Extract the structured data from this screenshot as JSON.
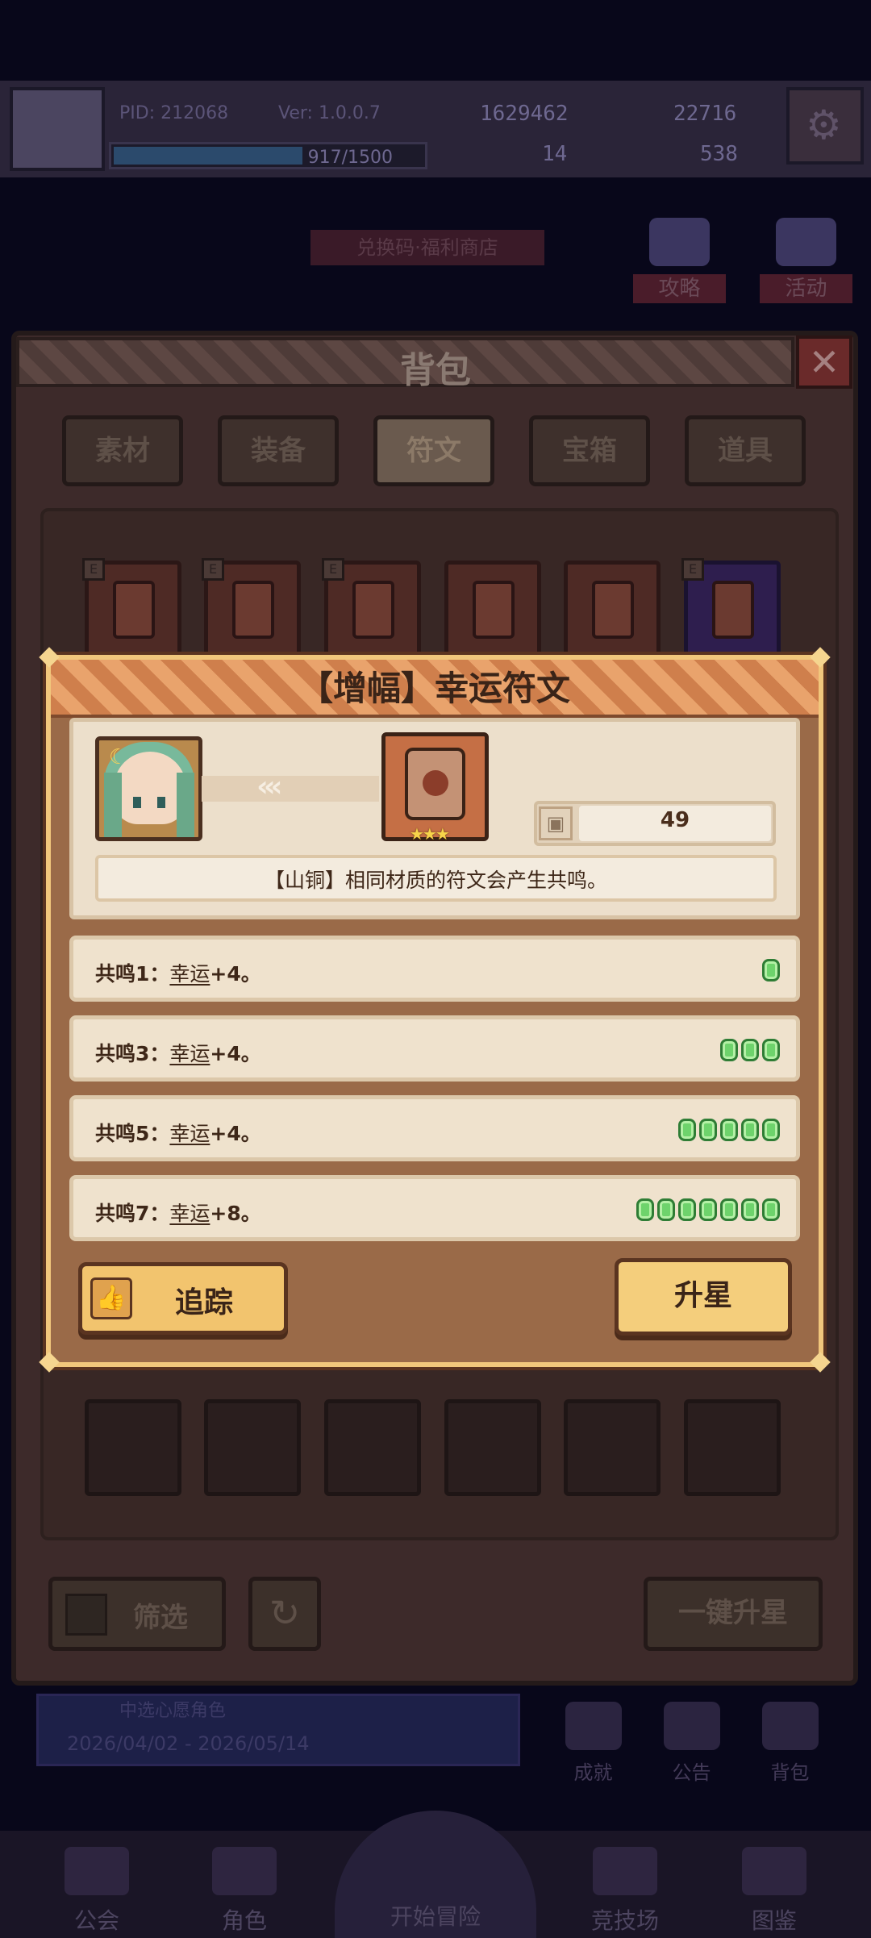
{
  "player": {
    "pid": "PID: 212068",
    "version": "Ver: 1.0.0.7",
    "coins": "1629462",
    "gems": "22716",
    "xp": "917/1500",
    "xp_fraction": 0.61,
    "clover": "14",
    "boots": "538"
  },
  "background": {
    "ribbon": "兑换码·福利商店",
    "side_buttons": [
      "攻略",
      "活动"
    ],
    "banner_top": "中选心愿角色",
    "banner_date": "2026/04/02 - 2026/05/14",
    "mini_buttons": [
      "成就",
      "公告",
      "背包"
    ],
    "nav": [
      "公会",
      "角色",
      "开始冒险",
      "竞技场",
      "图鉴"
    ]
  },
  "backpack": {
    "title": "背包",
    "close": "✕",
    "tabs": [
      "素材",
      "装备",
      "符文",
      "宝箱",
      "道具"
    ],
    "active_tab": "符文",
    "filter": "筛选",
    "refresh": "↻",
    "star_all": "一键升星",
    "slot_tag": "E"
  },
  "modal": {
    "title": "【增幅】幸运符文",
    "link_arrows": "‹‹‹",
    "stars": "★★★",
    "count_icon": "▣",
    "count": "49",
    "description": "【山铜】相同材质的符文会产生共鸣。",
    "resonances": [
      {
        "label": "共鸣1：",
        "stat": "幸运",
        "suffix": "+4。",
        "dots": 1
      },
      {
        "label": "共鸣3：",
        "stat": "幸运",
        "suffix": "+4。",
        "dots": 3
      },
      {
        "label": "共鸣5：",
        "stat": "幸运",
        "suffix": "+4。",
        "dots": 5
      },
      {
        "label": "共鸣7：",
        "stat": "幸运",
        "suffix": "+8。",
        "dots": 7
      }
    ],
    "track_button": "追踪",
    "track_icon": "👍",
    "star_button": "升星"
  },
  "colors": {
    "modal_frame": "#f1c77c",
    "header": "#df9660",
    "button": "#f2c46e",
    "resonance_dot": "#6ed36c"
  },
  "icons": [
    "settings-gear-icon",
    "close-icon",
    "thumbs-up-icon",
    "refresh-icon",
    "filter-grid-icon",
    "rune-icon",
    "count-box-icon"
  ]
}
